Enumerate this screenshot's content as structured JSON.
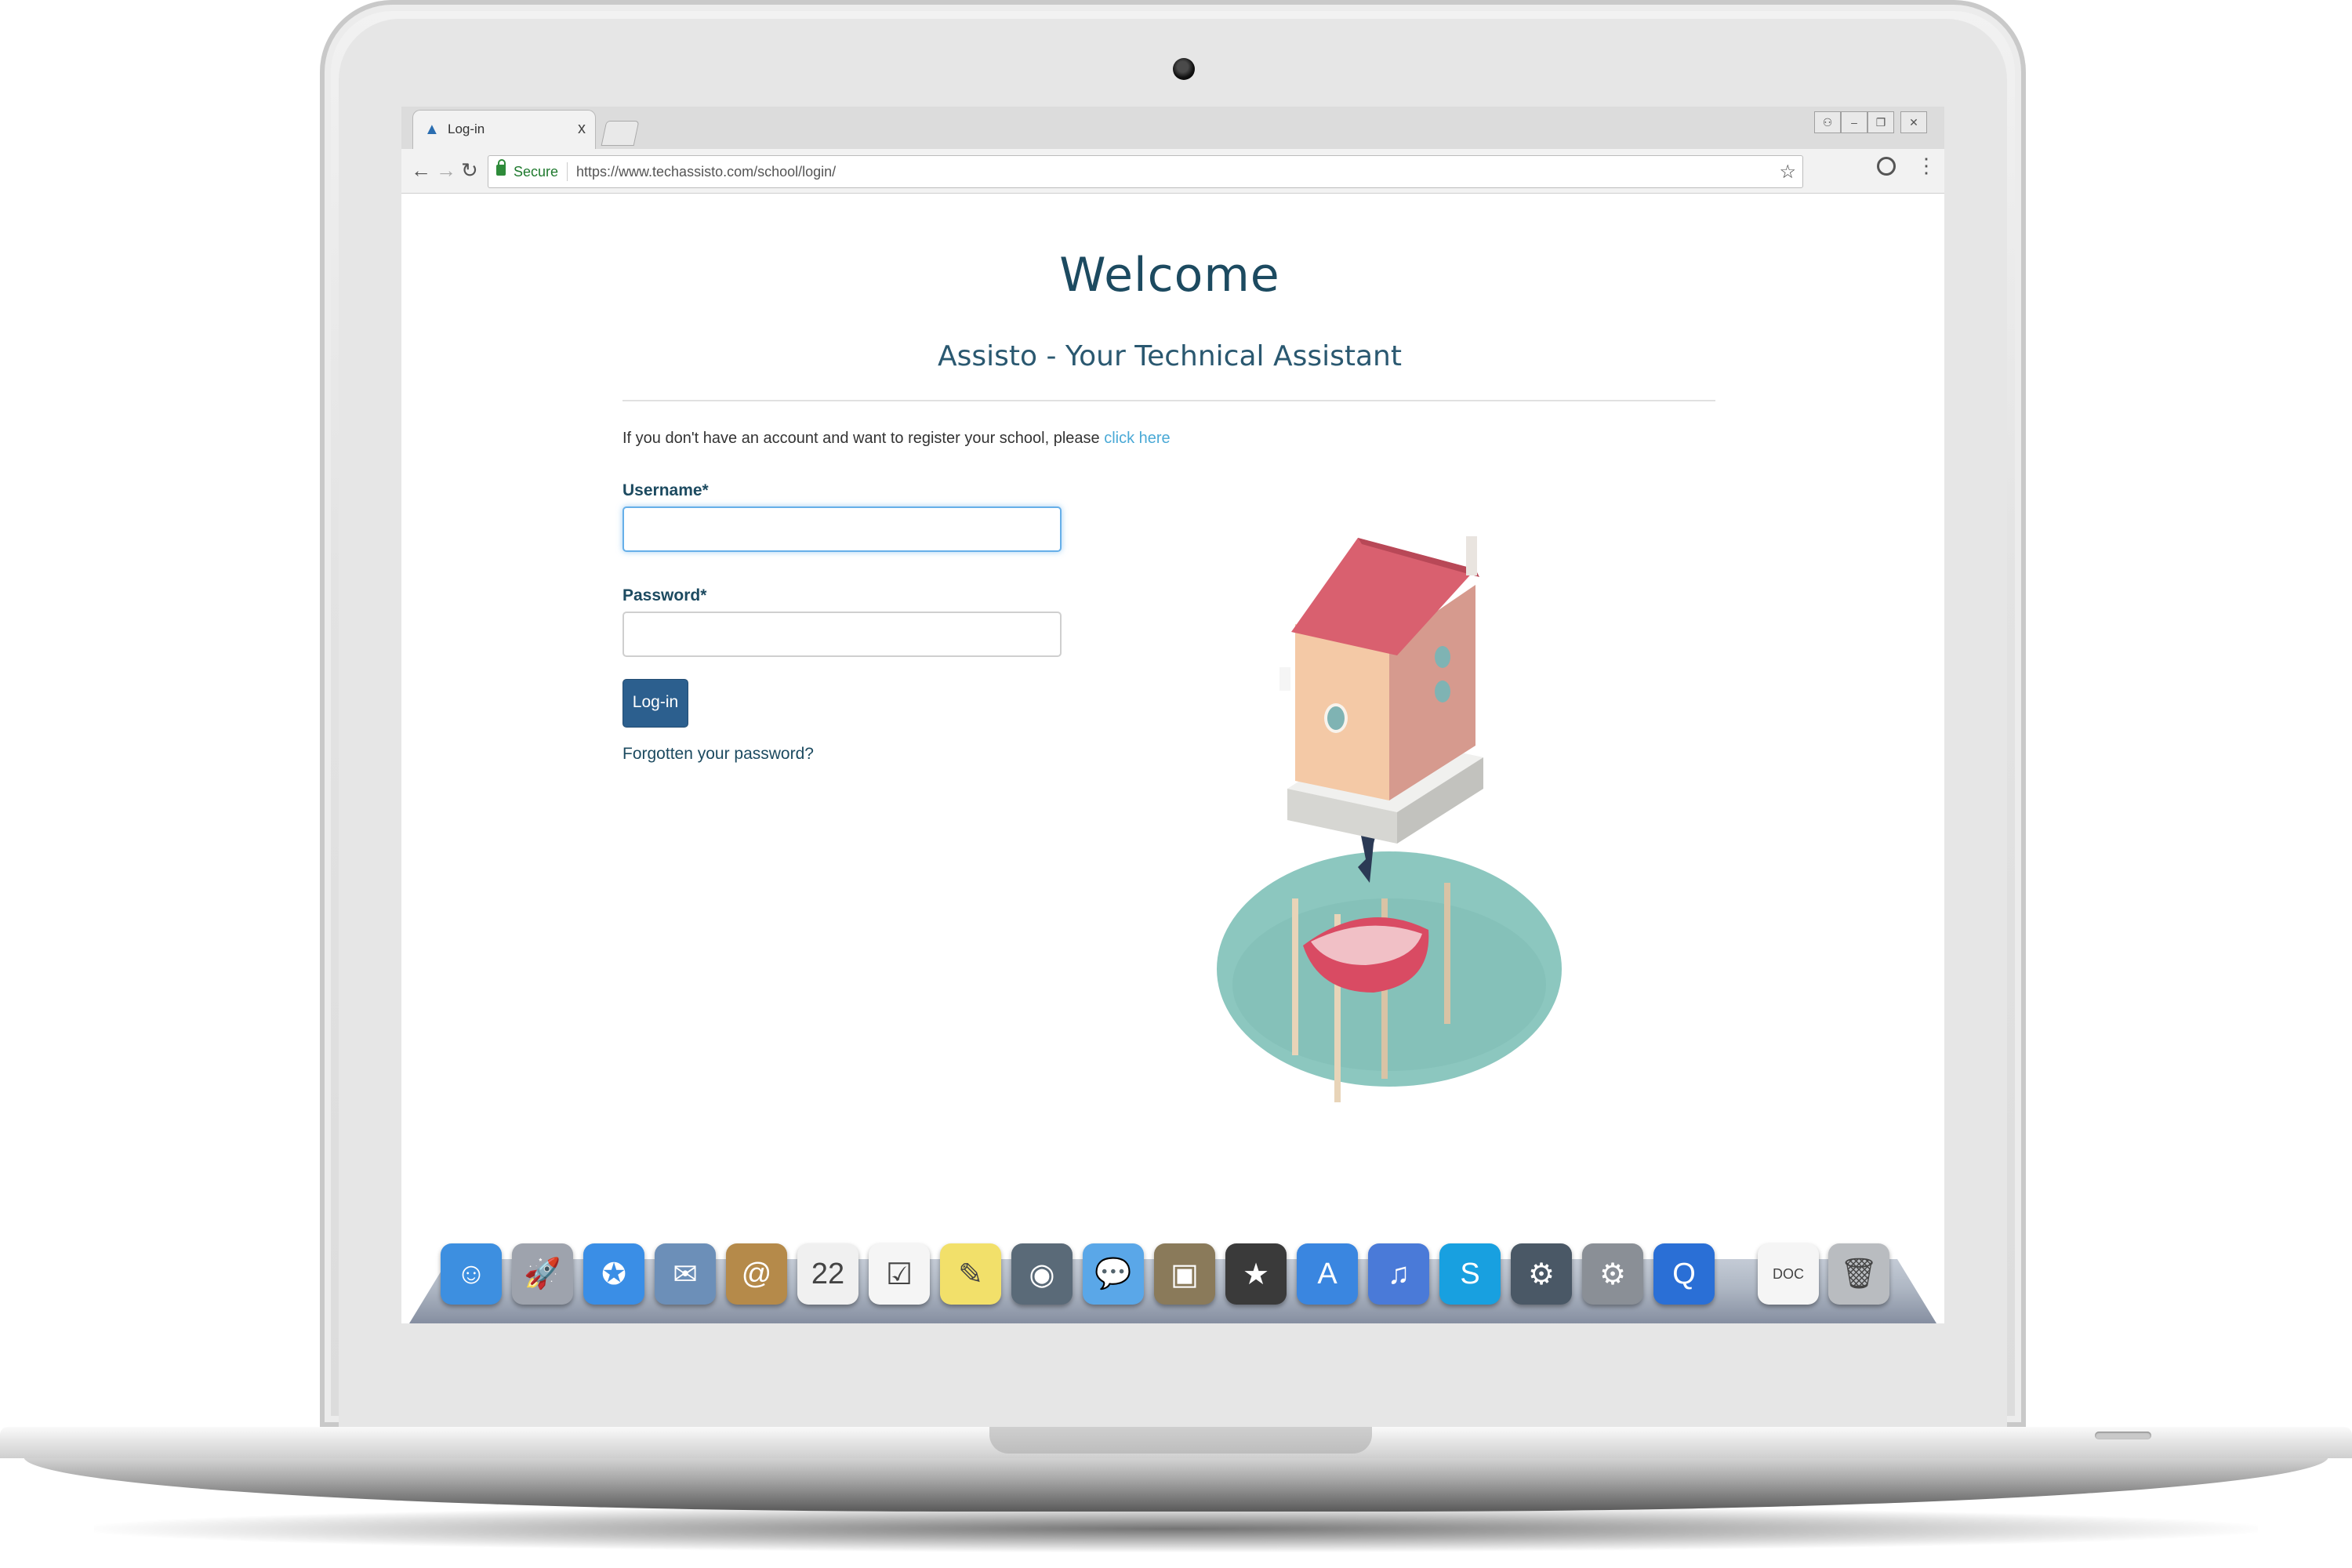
{
  "browser": {
    "tab_title": "Log-in",
    "tab_close": "x",
    "secure_label": "Secure",
    "url": "https://www.techassisto.com/school/login/",
    "back": "←",
    "forward": "→",
    "reload": "↻",
    "star": "☆",
    "menu": "⋮",
    "window_buttons": [
      "⚇",
      "–",
      "❐",
      "✕"
    ]
  },
  "page": {
    "title": "Welcome",
    "subtitle": "Assisto - Your Technical Assistant",
    "register_text": "If you don't have an account and want to register your school, please ",
    "register_link": "click here",
    "username_label": "Username*",
    "password_label": "Password*",
    "login_button": "Log-in",
    "forgot_link": "Forgotten your password?"
  },
  "dock": {
    "icons": [
      {
        "name": "finder-icon",
        "color": "#3d8fe0",
        "glyph": "☺"
      },
      {
        "name": "launchpad-icon",
        "color": "#9ea3ad",
        "glyph": "🚀"
      },
      {
        "name": "safari-icon",
        "color": "#3a8ee6",
        "glyph": "✪"
      },
      {
        "name": "mail-icon",
        "color": "#6c8fb8",
        "glyph": "✉"
      },
      {
        "name": "contacts-icon",
        "color": "#b58a4a",
        "glyph": "@"
      },
      {
        "name": "calendar-icon",
        "color": "#f0f0f0",
        "glyph": "22"
      },
      {
        "name": "reminders-icon",
        "color": "#f5f5f5",
        "glyph": "☑"
      },
      {
        "name": "stickies-icon",
        "color": "#f2e06a",
        "glyph": "✎"
      },
      {
        "name": "facetime-icon",
        "color": "#5a6a78",
        "glyph": "◉"
      },
      {
        "name": "messages-icon",
        "color": "#5aa7e8",
        "glyph": "💬"
      },
      {
        "name": "iphoto-icon",
        "color": "#8a7a5a",
        "glyph": "▣"
      },
      {
        "name": "imovie-icon",
        "color": "#3a3a3a",
        "glyph": "★"
      },
      {
        "name": "app-store-icon",
        "color": "#3a86e0",
        "glyph": "A"
      },
      {
        "name": "itunes-icon",
        "color": "#4a7ad8",
        "glyph": "♫"
      },
      {
        "name": "skype-icon",
        "color": "#18a0e0",
        "glyph": "S"
      },
      {
        "name": "steam-icon",
        "color": "#4a5866",
        "glyph": "⚙"
      },
      {
        "name": "system-preferences-icon",
        "color": "#8a8f96",
        "glyph": "⚙"
      },
      {
        "name": "quicktime-icon",
        "color": "#2a6fd6",
        "glyph": "Q"
      },
      {
        "name": "document-icon",
        "color": "#f5f5f5",
        "glyph": "DOC"
      },
      {
        "name": "trash-icon",
        "color": "#b9bcc0",
        "glyph": "🗑"
      }
    ]
  },
  "colors": {
    "heading": "#1c4a60",
    "link": "#4aa9d6",
    "button": "#2c5f8e",
    "focus": "#66afe9"
  }
}
